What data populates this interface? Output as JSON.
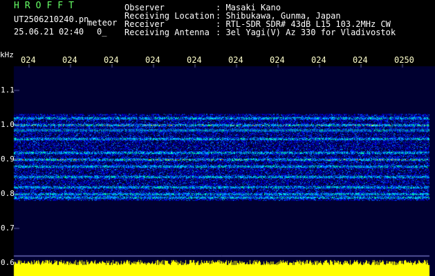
{
  "header": {
    "title": "HROFFT",
    "filename": "UT2506210240.pn",
    "meteor_label": "meteor",
    "timestamp": "25.06.21 02:40",
    "counter": "0_",
    "observer_label": "Observer",
    "observer_value": ": Masaki Kano",
    "location_label": "Receiving Location",
    "location_value": ": Shibukawa, Gunma, Japan",
    "receiver_label": "Receiver",
    "receiver_value": ": RTL-SDR SDR# 43dB L15 103.2MHz CW",
    "antenna_label": "Receiving Antenna",
    "antenna_value": ": 3el Yagi(V) Az 330 for Vladivostok"
  },
  "chart_data": {
    "type": "heatmap",
    "ylabel": "kHz",
    "x_ticks": [
      "024",
      "024",
      "024",
      "024",
      "024",
      "024",
      "024",
      "024",
      "024",
      "0250"
    ],
    "y_ticks": [
      "1.1",
      "1.0",
      "0.9",
      "0.8",
      "0.7",
      "0.6"
    ],
    "ylim": [
      0.6,
      1.1
    ],
    "signal_bands_khz": [
      1.02,
      1.0,
      0.985,
      0.96,
      0.92,
      0.9,
      0.88,
      0.85,
      0.82,
      0.8,
      0.79
    ],
    "colors": {
      "background": "#000030",
      "noise": "#0000ff",
      "signal": "#00ffff",
      "peak": "#ff0000",
      "power": "#ffff00"
    }
  }
}
